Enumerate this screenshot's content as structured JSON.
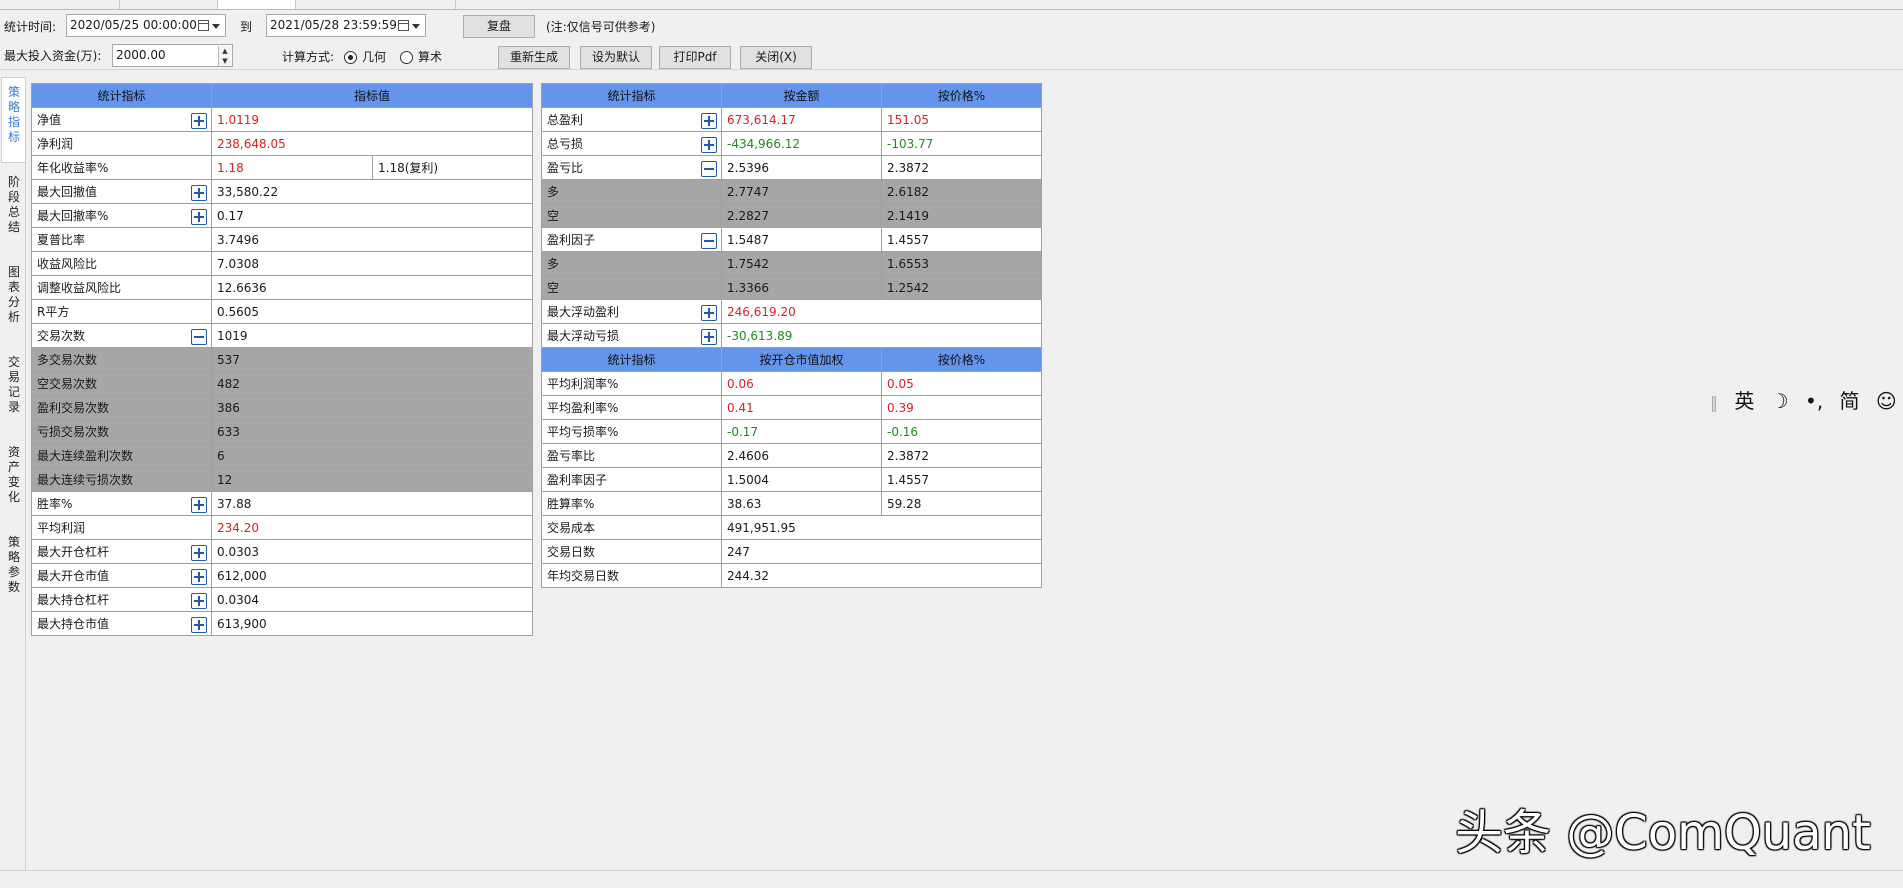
{
  "toolbar": {
    "period_label": "统计时间:",
    "start": "2020/05/25 00:00:00",
    "to": "到",
    "end": "2021/05/28 23:59:59",
    "replay_btn": "复盘",
    "note": "(注:仅信号可供参考)",
    "capital_label": "最大投入资金(万):",
    "capital": "2000.00",
    "calc_label": "计算方式:",
    "radio_geo": "几何",
    "radio_arith": "算术",
    "regen_btn": "重新生成",
    "default_btn": "设为默认",
    "pdf_btn": "打印Pdf",
    "close_btn": "关闭(X)"
  },
  "side_tabs": [
    "策略指标",
    "阶段总结",
    "图表分析",
    "交易记录",
    "资产变化",
    "策略参数"
  ],
  "left_table": {
    "headers": [
      "统计指标",
      "指标值"
    ],
    "rows": [
      {
        "label": "净值",
        "value": "1.0119",
        "color": "pos",
        "btn": "plus"
      },
      {
        "label": "净利润",
        "value": "238,648.05",
        "color": "pos"
      },
      {
        "label": "年化收益率%",
        "value": "1.18",
        "color": "pos",
        "extra": "1.18(复利)"
      },
      {
        "label": "最大回撤值",
        "value": "33,580.22",
        "btn": "plus"
      },
      {
        "label": "最大回撤率%",
        "value": "0.17",
        "btn": "plus"
      },
      {
        "label": "夏普比率",
        "value": "3.7496"
      },
      {
        "label": "收益风险比",
        "value": "7.0308"
      },
      {
        "label": "调整收益风险比",
        "value": "12.6636"
      },
      {
        "label": "R平方",
        "value": "0.5605"
      },
      {
        "label": "交易次数",
        "value": "1019",
        "btn": "minus"
      },
      {
        "label": "多交易次数",
        "value": "537",
        "gray": true
      },
      {
        "label": "空交易次数",
        "value": "482",
        "gray": true
      },
      {
        "label": "盈利交易次数",
        "value": "386",
        "gray": true
      },
      {
        "label": "亏损交易次数",
        "value": "633",
        "gray": true
      },
      {
        "label": "最大连续盈利次数",
        "value": "6",
        "gray": true
      },
      {
        "label": "最大连续亏损次数",
        "value": "12",
        "gray": true
      },
      {
        "label": "胜率%",
        "value": "37.88",
        "btn": "plus"
      },
      {
        "label": "平均利润",
        "value": "234.20",
        "color": "pos"
      },
      {
        "label": "最大开仓杠杆",
        "value": "0.0303",
        "btn": "plus"
      },
      {
        "label": "最大开仓市值",
        "value": "612,000",
        "btn": "plus"
      },
      {
        "label": "最大持仓杠杆",
        "value": "0.0304",
        "btn": "plus"
      },
      {
        "label": "最大持仓市值",
        "value": "613,900",
        "btn": "plus"
      }
    ]
  },
  "right_table": {
    "headers": [
      "统计指标",
      "按金额",
      "按价格%"
    ],
    "rows": [
      {
        "label": "总盈利",
        "v1": "673,614.17",
        "v2": "151.05",
        "color": "pos",
        "btn": "plus"
      },
      {
        "label": "总亏损",
        "v1": "-434,966.12",
        "v2": "-103.77",
        "color": "neg",
        "btn": "plus"
      },
      {
        "label": "盈亏比",
        "v1": "2.5396",
        "v2": "2.3872",
        "btn": "minus"
      },
      {
        "label": "多",
        "v1": "2.7747",
        "v2": "2.6182",
        "gray": true
      },
      {
        "label": "空",
        "v1": "2.2827",
        "v2": "2.1419",
        "gray": true
      },
      {
        "label": "盈利因子",
        "v1": "1.5487",
        "v2": "1.4557",
        "btn": "minus"
      },
      {
        "label": "多",
        "v1": "1.7542",
        "v2": "1.6553",
        "gray": true
      },
      {
        "label": "空",
        "v1": "1.3366",
        "v2": "1.2542",
        "gray": true
      },
      {
        "label": "最大浮动盈利",
        "v1": "246,619.20",
        "color": "pos",
        "btn": "plus",
        "span": true
      },
      {
        "label": "最大浮动亏损",
        "v1": "-30,613.89",
        "color": "neg",
        "btn": "plus",
        "span": true
      }
    ],
    "headers2": [
      "统计指标",
      "按开仓市值加权",
      "按价格%"
    ],
    "rows2": [
      {
        "label": "平均利润率%",
        "v1": "0.06",
        "v2": "0.05",
        "color": "pos"
      },
      {
        "label": "平均盈利率%",
        "v1": "0.41",
        "v2": "0.39",
        "color": "pos"
      },
      {
        "label": "平均亏损率%",
        "v1": "-0.17",
        "v2": "-0.16",
        "color": "neg"
      },
      {
        "label": "盈亏率比",
        "v1": "2.4606",
        "v2": "2.3872"
      },
      {
        "label": "盈利率因子",
        "v1": "1.5004",
        "v2": "1.4557"
      },
      {
        "label": "胜算率%",
        "v1": "38.63",
        "v2": "59.28"
      },
      {
        "label": "交易成本",
        "v1": "491,951.95",
        "span": true
      },
      {
        "label": "交易日数",
        "v1": "247",
        "span": true
      },
      {
        "label": "年均交易日数",
        "v1": "244.32",
        "span": true
      }
    ]
  },
  "ime_bar": {
    "items": [
      "英",
      "☽",
      "•,",
      "简",
      "☺",
      "⚙"
    ]
  },
  "watermark": "头条 @ComQuant"
}
